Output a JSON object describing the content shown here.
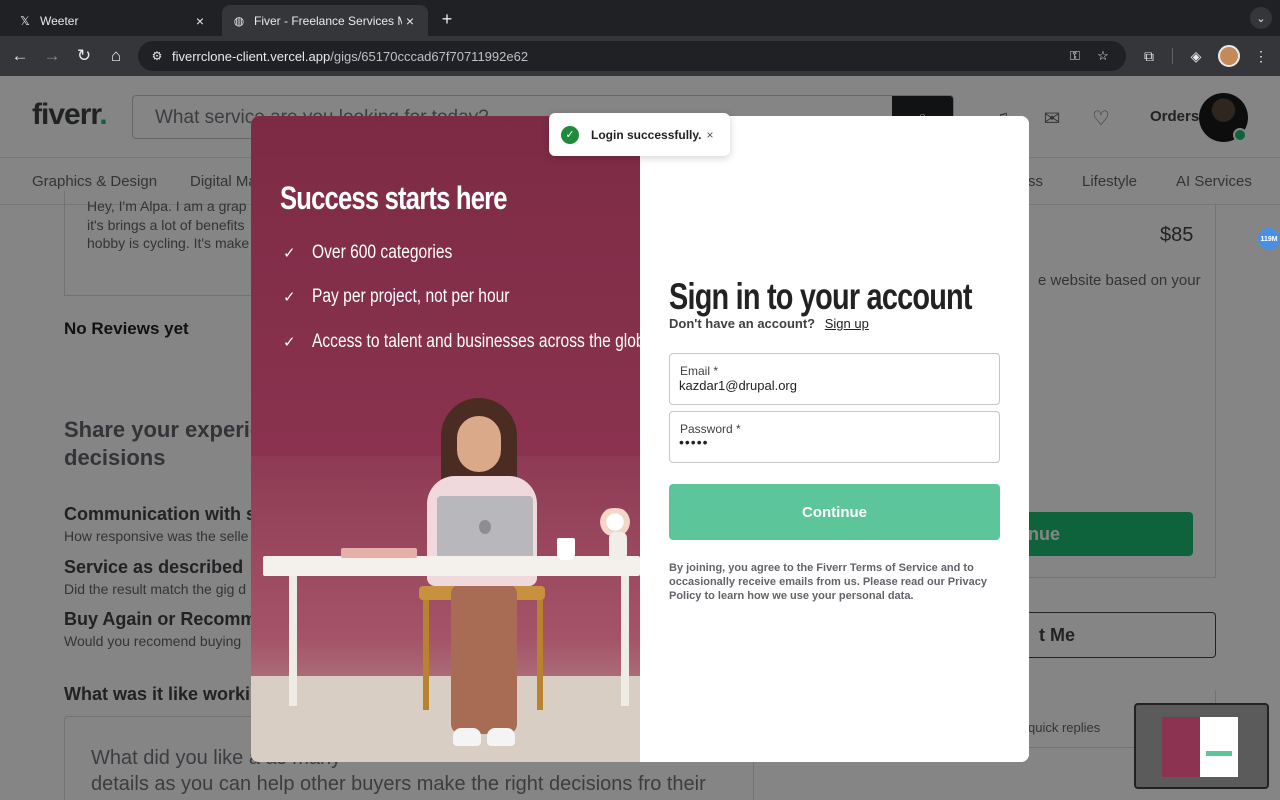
{
  "browser": {
    "tabs": [
      {
        "title": "Weeter",
        "icon": "x-logo-icon"
      },
      {
        "title": "Fiver - Freelance Services Ma",
        "icon": "globe-icon"
      }
    ],
    "url_host": "fiverrclone-client.vercel.app",
    "url_path": "/gigs/65170cccad67f70711992e62"
  },
  "header": {
    "logo_text": "fiverr",
    "logo_dot": ".",
    "search_placeholder": "What service are you looking for today?",
    "orders_label": "Orders"
  },
  "categories": [
    "Graphics & Design",
    "Digital Ma",
    "ss",
    "Lifestyle",
    "AI Services"
  ],
  "background": {
    "bio": "Hey, I'm Alpa. I am a grap\nit's brings a lot of benefits\nhobby is cycling. It's make",
    "no_reviews": "No Reviews yet",
    "share_heading": "Share your experie\ndecisions",
    "criteria": [
      {
        "title": "Communication with se",
        "sub": "How responsive was the selle"
      },
      {
        "title": "Service as described",
        "sub": "Did the result match the gig d"
      },
      {
        "title": "Buy Again or Recomme",
        "sub": "Would you recomend buying"
      }
    ],
    "working_heading": "What was it like worki",
    "textarea_placeholder": "What did you like a                                                  as many\ndetails as you can help other buyers make the right decisions fro their",
    "price": "$85",
    "description_fragment": "e website based on your",
    "continue_fragment": "nue",
    "contact_fragment": "t Me",
    "quick_fragment": "quick replies",
    "chip_text": "119M"
  },
  "modal": {
    "left_title": "Success starts here",
    "benefits": [
      "Over 600 categories",
      "Pay per project, not per hour",
      "Access to talent and businesses across the globe"
    ],
    "title": "Sign in to your account",
    "no_account": "Don't have an account?",
    "signup_link": "Sign up",
    "email_label": "Email *",
    "email_value": "kazdar1@drupal.org",
    "password_label": "Password *",
    "password_value": "•••••",
    "continue_label": "Continue",
    "terms": "By joining, you agree to the Fiverr Terms of Service and to occasionally receive emails from us. Please read our Privacy Policy to learn how we use your personal data."
  },
  "toast": {
    "message": "Login successfully.",
    "status_color": "#1f8a3b"
  },
  "colors": {
    "brand_green": "#1dbf73",
    "modal_left_bg": "#7d2b45",
    "continue_bg": "#5cc69a"
  }
}
